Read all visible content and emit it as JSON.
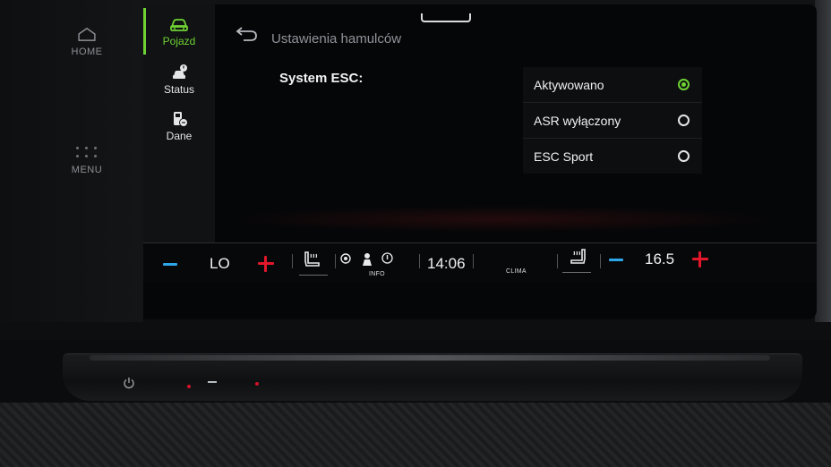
{
  "hardkeys": {
    "home_label": "HOME",
    "menu_label": "MENU"
  },
  "sidenav": {
    "items": [
      {
        "label": "Pojazd",
        "icon": "car-icon",
        "active": true
      },
      {
        "label": "Status",
        "icon": "car-status-icon",
        "active": false
      },
      {
        "label": "Dane",
        "icon": "fuel-data-icon",
        "active": false
      }
    ]
  },
  "header": {
    "title": "Ustawienia hamulców",
    "back_icon": "back-arrow-icon"
  },
  "esc": {
    "label": "System ESC:",
    "options": [
      {
        "label": "Aktywowano",
        "selected": true
      },
      {
        "label": "ASR wyłączony",
        "selected": false
      },
      {
        "label": "ESC Sport",
        "selected": false
      }
    ]
  },
  "climate": {
    "left_temp": "LO",
    "right_temp": "16.5",
    "clock": "14:06",
    "info_label": "INFO",
    "clima_label": "CLIMA"
  },
  "colors": {
    "accent_green": "#6fd233",
    "minus_blue": "#2ea6ea",
    "plus_red": "#e3162a"
  }
}
